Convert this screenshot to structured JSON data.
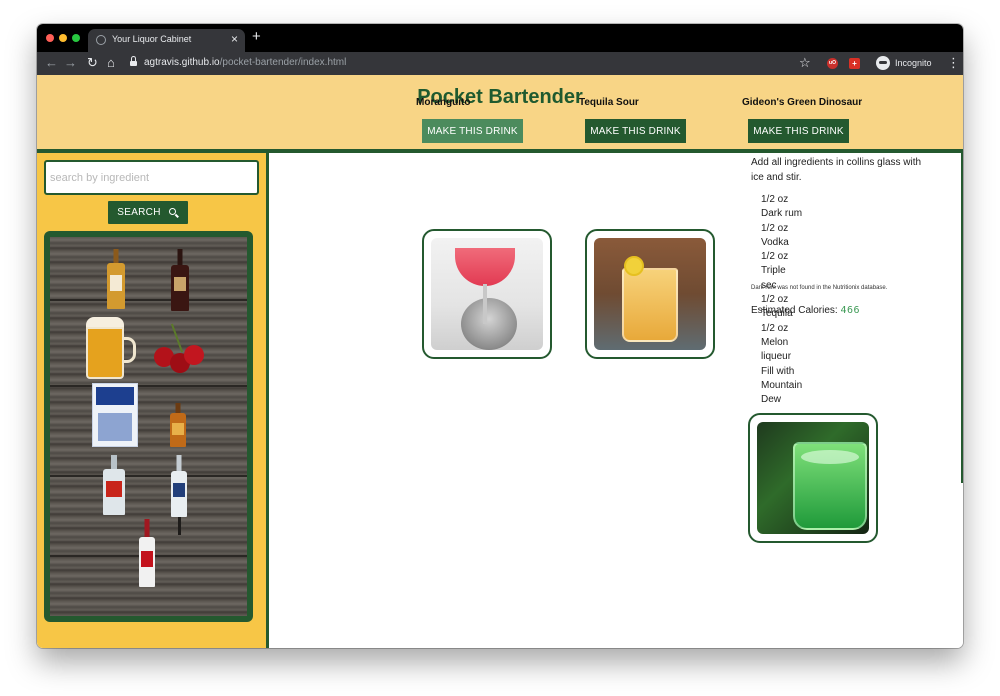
{
  "browser": {
    "tab_title": "Your Liquor Cabinet",
    "tab_close": "×",
    "new_tab": "+",
    "url_host": "agtravis.github.io",
    "url_path": "/pocket-bartender/index.html",
    "profile_label": "Incognito",
    "nav_icons": {
      "back": "←",
      "forward": "→",
      "reload": "↻",
      "home": "⌂",
      "star": "☆",
      "menu": "⋮"
    }
  },
  "page": {
    "title": "Pocket Bartender"
  },
  "sidebar": {
    "search_placeholder": "search by ingredient",
    "search_button": "SEARCH"
  },
  "drinks": [
    {
      "name": "Moranguito",
      "button": "MAKE THIS DRINK"
    },
    {
      "name": "Tequila Sour",
      "button": "MAKE THIS DRINK"
    },
    {
      "name": "Gideon's Green Dinosaur",
      "button": "MAKE THIS DRINK",
      "instructions": "Add all ingredients in collins glass with ice and stir.",
      "ingredients": [
        "1/2 oz Dark rum",
        "1/2 oz Vodka",
        "1/2 oz Triple sec",
        "1/2 oz Tequila",
        "1/2 oz Melon liqueur",
        "Fill with Mountain Dew"
      ],
      "note": "Dark rum was not found in the Nutritionix database.",
      "calories_label": "Estimated Calories:",
      "calories_value": "466"
    }
  ],
  "colors": {
    "header_bg": "#f8d586",
    "sidebar_bg": "#f7c646",
    "brand_green": "#24592f",
    "title_green": "#1f5a2f",
    "calorie_green": "#3d9a55"
  }
}
